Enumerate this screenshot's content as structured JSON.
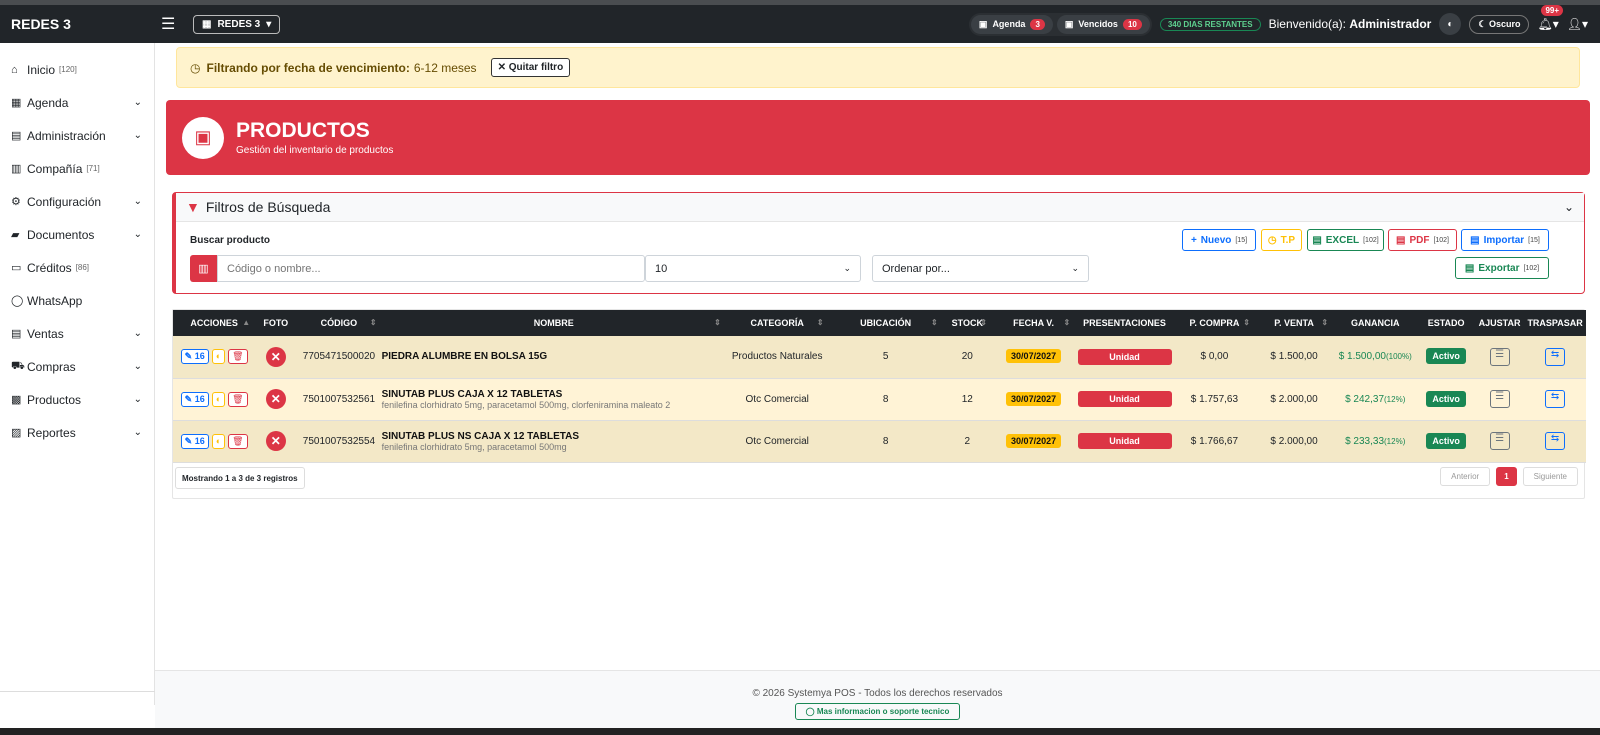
{
  "navbar": {
    "brand": "REDES 3",
    "company": "REDES 3",
    "agenda_label": "Agenda",
    "agenda_count": "3",
    "vencidos_label": "Vencidos",
    "vencidos_count": "10",
    "days_left": "340 DIAS RESTANTES",
    "welcome": "Bienvenido(a):",
    "user": "Administrador",
    "theme_label": "Oscuro",
    "notif_count": "99+"
  },
  "sidebar": {
    "items": [
      {
        "label": "Inicio",
        "count": "[120]",
        "icon": "home-icon",
        "chevron": false
      },
      {
        "label": "Agenda",
        "count": "",
        "icon": "calendar-icon",
        "chevron": true
      },
      {
        "label": "Administración",
        "count": "",
        "icon": "id-card-icon",
        "chevron": true
      },
      {
        "label": "Compañía",
        "count": "[71]",
        "icon": "building-icon",
        "chevron": false
      },
      {
        "label": "Configuración",
        "count": "",
        "icon": "gears-icon",
        "chevron": true
      },
      {
        "label": "Documentos",
        "count": "",
        "icon": "folder-icon",
        "chevron": true
      },
      {
        "label": "Créditos",
        "count": "[86]",
        "icon": "credit-card-icon",
        "chevron": false
      },
      {
        "label": "WhatsApp",
        "count": "",
        "icon": "whatsapp-icon",
        "chevron": false
      },
      {
        "label": "Ventas",
        "count": "",
        "icon": "register-icon",
        "chevron": true
      },
      {
        "label": "Compras",
        "count": "",
        "icon": "cart-icon",
        "chevron": true
      },
      {
        "label": "Productos",
        "count": "",
        "icon": "boxes-icon",
        "chevron": true
      },
      {
        "label": "Reportes",
        "count": "",
        "icon": "chart-icon",
        "chevron": true
      }
    ]
  },
  "alert": {
    "label": "Filtrando por fecha de vencimiento:",
    "value": "6-12 meses",
    "button": "Quitar filtro"
  },
  "hero": {
    "title": "PRODUCTOS",
    "subtitle": "Gestión del inventario de productos"
  },
  "filters": {
    "title": "Filtros de Búsqueda",
    "search_label": "Buscar producto",
    "search_placeholder": "Código o nombre...",
    "page_size": "10",
    "order_placeholder": "Ordenar por...",
    "buttons": {
      "nuevo": "Nuevo",
      "nuevo_n": "[15]",
      "tp": "T.P",
      "excel": "EXCEL",
      "excel_n": "[102]",
      "pdf": "PDF",
      "pdf_n": "[102]",
      "importar": "Importar",
      "importar_n": "[15]",
      "exportar": "Exportar",
      "exportar_n": "[102]"
    }
  },
  "table": {
    "headers": [
      "ACCIONES",
      "FOTO",
      "CÓDIGO",
      "NOMBRE",
      "CATEGORÍA",
      "UBICACIÓN",
      "STOCK",
      "FECHA V.",
      "PRESENTACIONES",
      "P. COMPRA",
      "P. VENTA",
      "GANANCIA",
      "ESTADO",
      "AJUSTAR",
      "TRASPASAR"
    ],
    "rows": [
      {
        "edit": "16",
        "code": "7705471500020",
        "name": "PIEDRA ALUMBRE EN BOLSA 15G",
        "desc": "",
        "category": "Productos Naturales",
        "location": "5",
        "stock": "20",
        "date": "30/07/2027",
        "presentation": "Unidad",
        "buy": "$ 0,00",
        "sell": "$ 1.500,00",
        "gain": "$ 1.500,00",
        "gain_pct": "(100%)",
        "status": "Activo"
      },
      {
        "edit": "16",
        "code": "7501007532561",
        "name": "SINUTAB PLUS CAJA X 12 TABLETAS",
        "desc": "fenilefina clorhidrato 5mg, paracetamol 500mg, clorfeniramina maleato 2",
        "category": "Otc Comercial",
        "location": "8",
        "stock": "12",
        "date": "30/07/2027",
        "presentation": "Unidad",
        "buy": "$ 1.757,63",
        "sell": "$ 2.000,00",
        "gain": "$ 242,37",
        "gain_pct": "(12%)",
        "status": "Activo"
      },
      {
        "edit": "16",
        "code": "7501007532554",
        "name": "SINUTAB PLUS NS CAJA X 12 TABLETAS",
        "desc": "fenilefina clorhidrato 5mg, paracetamol 500mg",
        "category": "Otc Comercial",
        "location": "8",
        "stock": "2",
        "date": "30/07/2027",
        "presentation": "Unidad",
        "buy": "$ 1.766,67",
        "sell": "$ 2.000,00",
        "gain": "$ 233,33",
        "gain_pct": "(12%)",
        "status": "Activo"
      }
    ],
    "info": "Mostrando 1 a 3 de 3 registros",
    "prev": "Anterior",
    "page": "1",
    "next": "Siguiente"
  },
  "footer": {
    "copyright": "© 2026 Systemya POS - Todos los derechos reservados",
    "help": "Mas informacion o soporte tecnico"
  },
  "colors": {
    "primary_red": "#dc3545",
    "dark": "#212529",
    "success": "#198754",
    "warning": "#ffc107",
    "info_blue": "#0d6efd"
  }
}
